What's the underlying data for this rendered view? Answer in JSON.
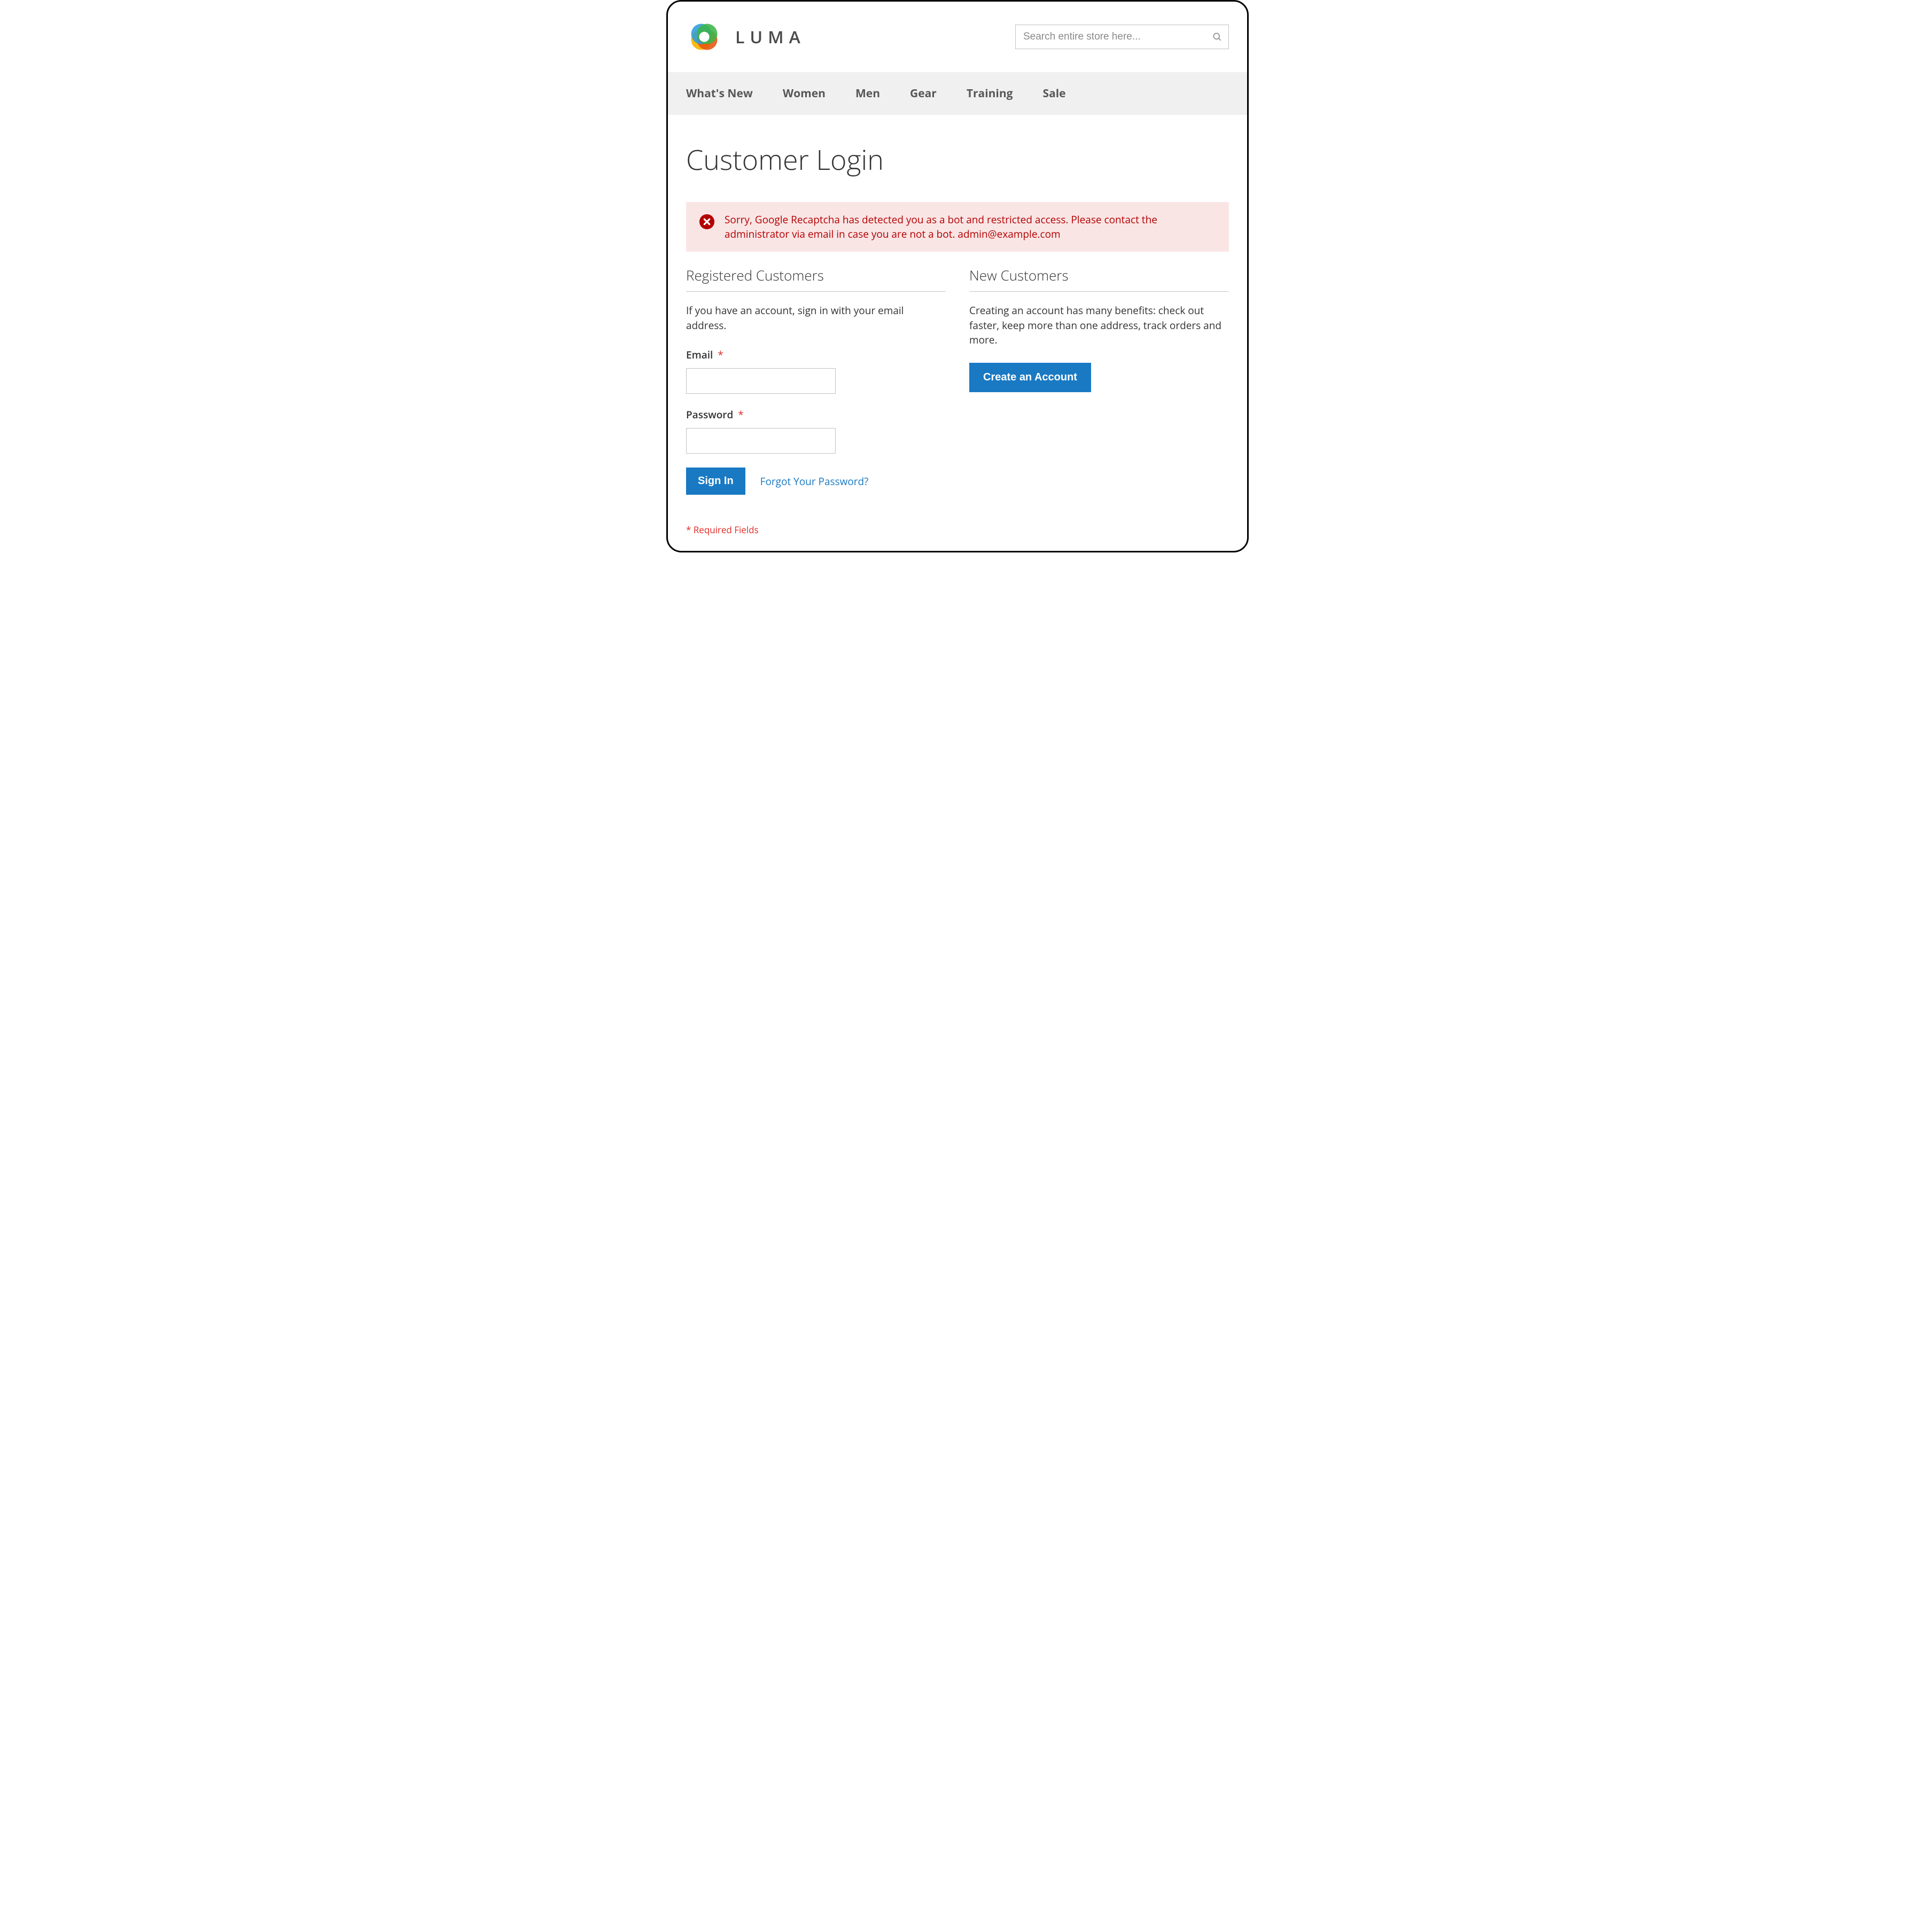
{
  "brand": {
    "name": "LUMA"
  },
  "search": {
    "placeholder": "Search entire store here..."
  },
  "nav": {
    "items": [
      {
        "label": "What's New"
      },
      {
        "label": "Women"
      },
      {
        "label": "Men"
      },
      {
        "label": "Gear"
      },
      {
        "label": "Training"
      },
      {
        "label": "Sale"
      }
    ]
  },
  "page": {
    "title": "Customer Login"
  },
  "alert": {
    "message": "Sorry, Google Recaptcha has detected you as a bot and restricted access. Please contact the administrator via email in case you are not a bot. admin@example.com"
  },
  "login": {
    "section_title": "Registered Customers",
    "description": "If you have an account, sign in with your email address.",
    "email_label": "Email",
    "password_label": "Password",
    "required_mark": "*",
    "email_value": "",
    "password_value": "",
    "sign_in_label": "Sign In",
    "forgot_label": "Forgot Your Password?",
    "required_note": "* Required Fields"
  },
  "register": {
    "section_title": "New Customers",
    "description": "Creating an account has many benefits: check out faster, keep more than one address, track orders and more.",
    "create_label": "Create an Account"
  },
  "colors": {
    "accent": "#1979c3",
    "error": "#e02b27",
    "alert_bg": "#fae5e5"
  }
}
